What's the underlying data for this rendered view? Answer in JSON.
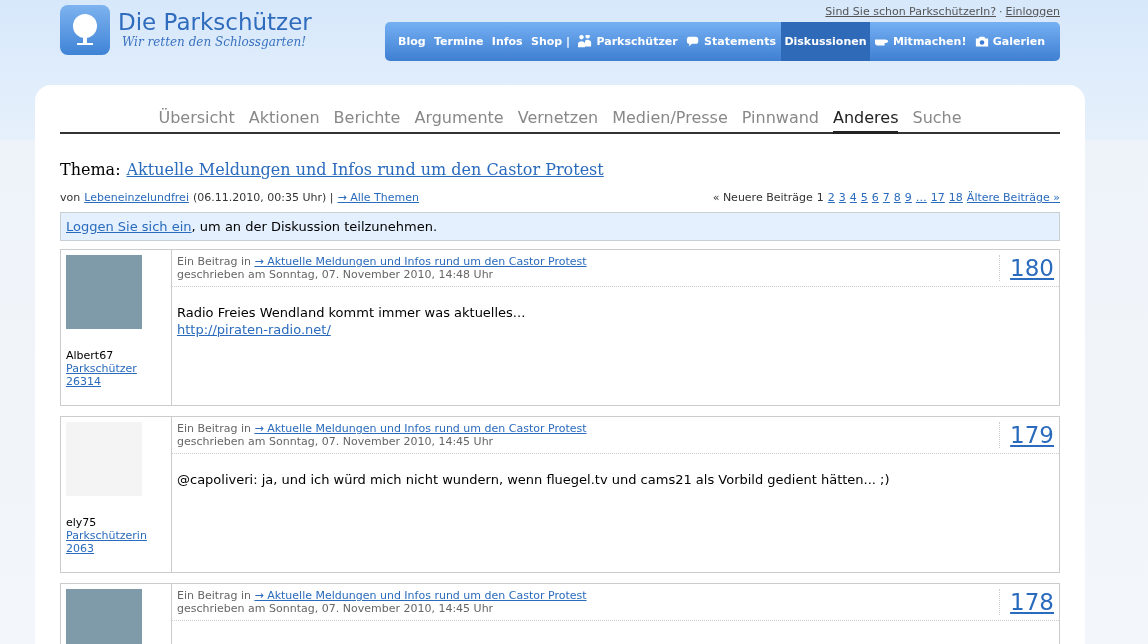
{
  "logo": {
    "title": "Die Parkschützer",
    "tagline": "Wir retten den Schlossgarten!"
  },
  "account": {
    "question": "Sind Sie schon ParkschützerIn?",
    "separator": "·",
    "login": "Einloggen"
  },
  "main_nav": [
    {
      "label": "Blog",
      "kind": "plain",
      "selected": false
    },
    {
      "label": "Termine",
      "kind": "plain",
      "selected": false
    },
    {
      "label": "Infos",
      "kind": "plain",
      "selected": false
    },
    {
      "label": "Shop |",
      "kind": "plain",
      "selected": false
    },
    {
      "label": "Parkschützer",
      "kind": "people",
      "selected": false
    },
    {
      "label": "Statements",
      "kind": "speech",
      "selected": false
    },
    {
      "label": "Diskussionen",
      "kind": "plain",
      "selected": true
    },
    {
      "label": "Mitmachen!",
      "kind": "hand",
      "selected": false
    },
    {
      "label": "Galerien",
      "kind": "camera",
      "selected": false
    }
  ],
  "tabs": [
    {
      "label": "Übersicht",
      "selected": false
    },
    {
      "label": "Aktionen",
      "selected": false
    },
    {
      "label": "Berichte",
      "selected": false
    },
    {
      "label": "Argumente",
      "selected": false
    },
    {
      "label": "Vernetzen",
      "selected": false
    },
    {
      "label": "Medien/Presse",
      "selected": false
    },
    {
      "label": "Pinnwand",
      "selected": false
    },
    {
      "label": "Anderes",
      "selected": true
    },
    {
      "label": "Suche",
      "selected": false
    }
  ],
  "topic": {
    "prefix": "Thema:",
    "title": "Aktuelle Meldungen und Infos rund um den Castor Protest",
    "by": "von",
    "author": "Lebeneinzelundfrei",
    "date": "(06.11.2010, 00:35 Uhr) |",
    "all_topics": "→ Alle Themen"
  },
  "pagination": {
    "newer": "« Neuere Beiträge",
    "pages": [
      {
        "label": "1",
        "selected": true
      },
      {
        "label": "2",
        "selected": false
      },
      {
        "label": "3",
        "selected": false
      },
      {
        "label": "4",
        "selected": false
      },
      {
        "label": "5",
        "selected": false
      },
      {
        "label": "6",
        "selected": false
      },
      {
        "label": "7",
        "selected": false
      },
      {
        "label": "8",
        "selected": false
      },
      {
        "label": "9",
        "selected": false
      },
      {
        "label": "…",
        "selected": false
      },
      {
        "label": "17",
        "selected": false
      },
      {
        "label": "18",
        "selected": false
      }
    ],
    "older": "Ältere Beiträge »"
  },
  "login_notice": {
    "link": "Loggen Sie sich ein",
    "text": ", um an der Diskussion teilzunehmen."
  },
  "posts": [
    {
      "username": "Albert67",
      "role": "Parkschützer",
      "member_no": "26314",
      "prefix": "Ein Beitrag in",
      "topic_link": "→ Aktuelle Meldungen und Infos rund um den Castor Protest",
      "written": "geschrieben am Sonntag, 07. November 2010, 14:48 Uhr",
      "number": "180",
      "body": [
        {
          "kind": "text",
          "text": "Radio Freies Wendland kommt immer was aktuelles..."
        },
        {
          "kind": "link",
          "text": "http://piraten-radio.net/"
        }
      ]
    },
    {
      "username": "ely75",
      "role": "Parkschützerin",
      "member_no": "2063",
      "prefix": "Ein Beitrag in",
      "topic_link": "→ Aktuelle Meldungen und Infos rund um den Castor Protest",
      "written": "geschrieben am Sonntag, 07. November 2010, 14:45 Uhr",
      "number": "179",
      "body": [
        {
          "kind": "text",
          "text": "@capoliveri: ja, und ich würd mich nicht wundern, wenn fluegel.tv und cams21 als Vorbild gedient hätten... ;)"
        }
      ]
    },
    {
      "prefix": "Ein Beitrag in",
      "topic_link": "→ Aktuelle Meldungen und Infos rund um den Castor Protest",
      "written": "geschrieben am Sonntag, 07. November 2010, 14:45 Uhr",
      "number": "178"
    }
  ]
}
